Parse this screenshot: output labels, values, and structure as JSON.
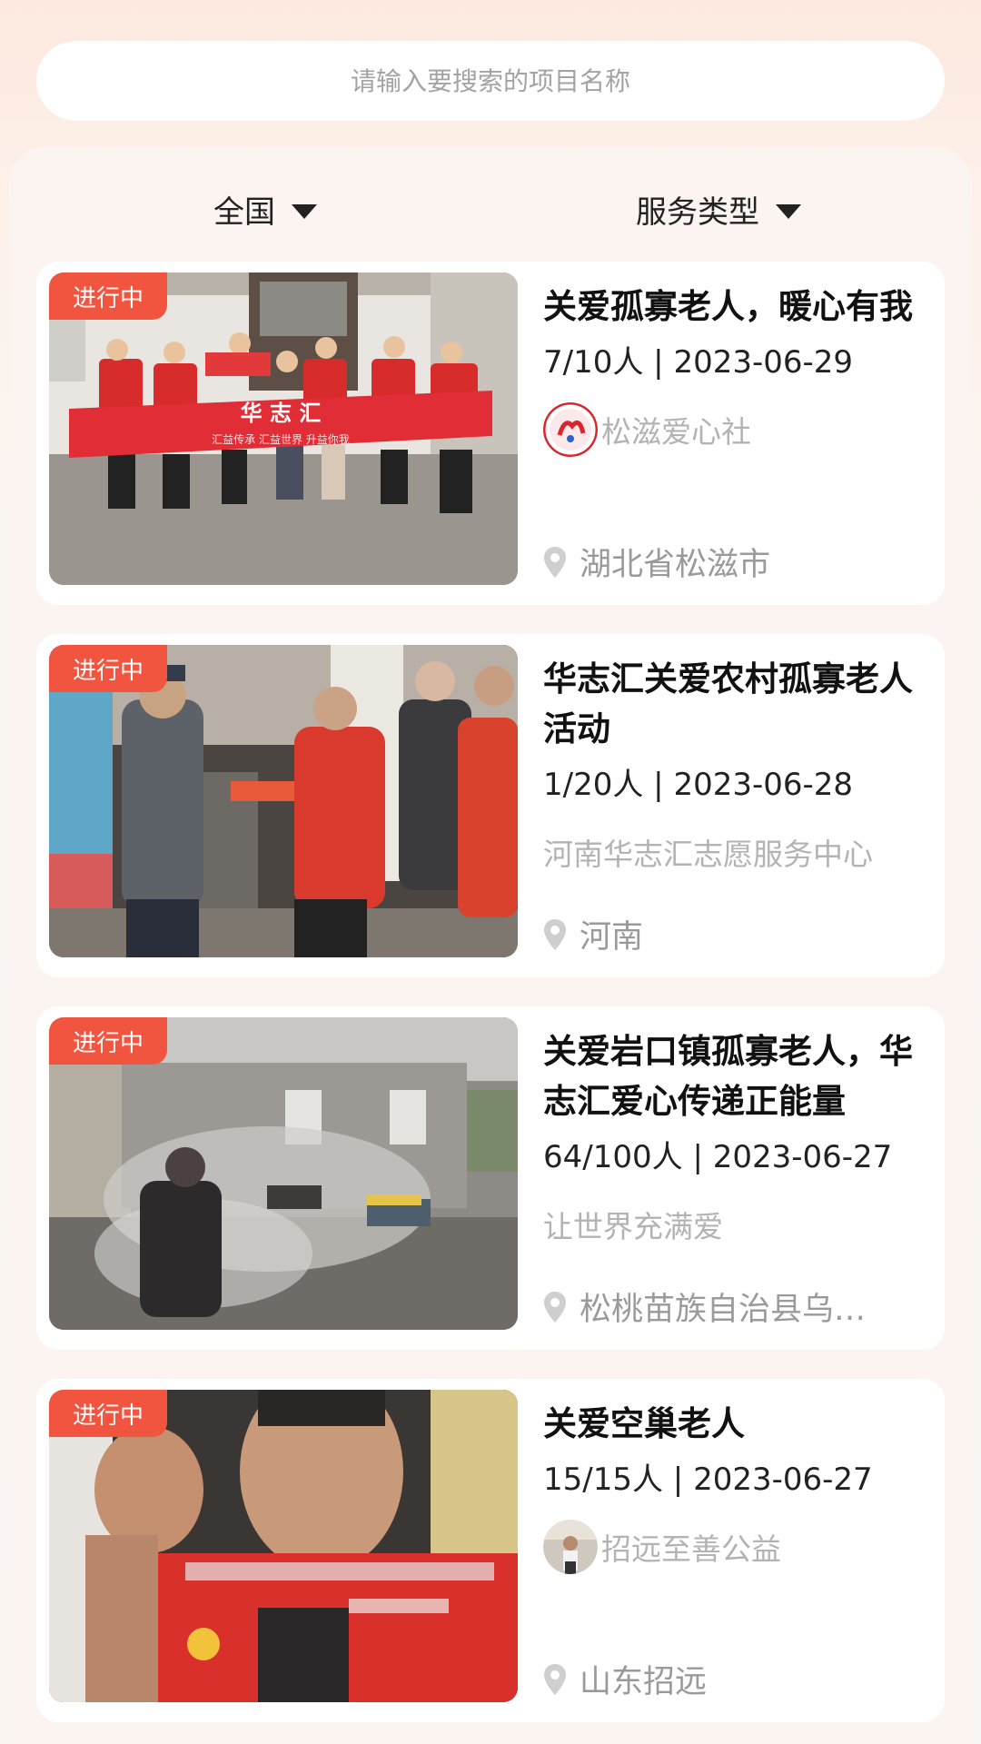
{
  "search": {
    "placeholder": "请输入要搜索的项目名称"
  },
  "filters": {
    "region": "全国",
    "service_type": "服务类型"
  },
  "colors": {
    "accent": "#f2553f",
    "org_text": "#b3b3b3",
    "location_text": "#9a9a9a"
  },
  "projects": [
    {
      "status": "进行中",
      "title": "关爱孤寡老人，暖心有我",
      "participants": "7/10人",
      "date": "2023-06-29",
      "org": "松滋爱心社",
      "location": "湖北省松滋市",
      "banner_text": "华 志 汇",
      "banner_sub": "汇益传承   汇益世界   升益你我"
    },
    {
      "status": "进行中",
      "title": "华志汇关爱农村孤寡老人活动",
      "participants": "1/20人",
      "date": "2023-06-28",
      "org": "河南华志汇志愿服务中心",
      "location": "河南"
    },
    {
      "status": "进行中",
      "title": "关爱岩口镇孤寡老人，华志汇爱心传递正能量",
      "participants": "64/100人",
      "date": "2023-06-27",
      "org": "让世界充满爱",
      "location": "松桃苗族自治县乌…"
    },
    {
      "status": "进行中",
      "title": "关爱空巢老人",
      "participants": "15/15人",
      "date": "2023-06-27",
      "org": "招远至善公益",
      "location": "山东招远"
    }
  ]
}
